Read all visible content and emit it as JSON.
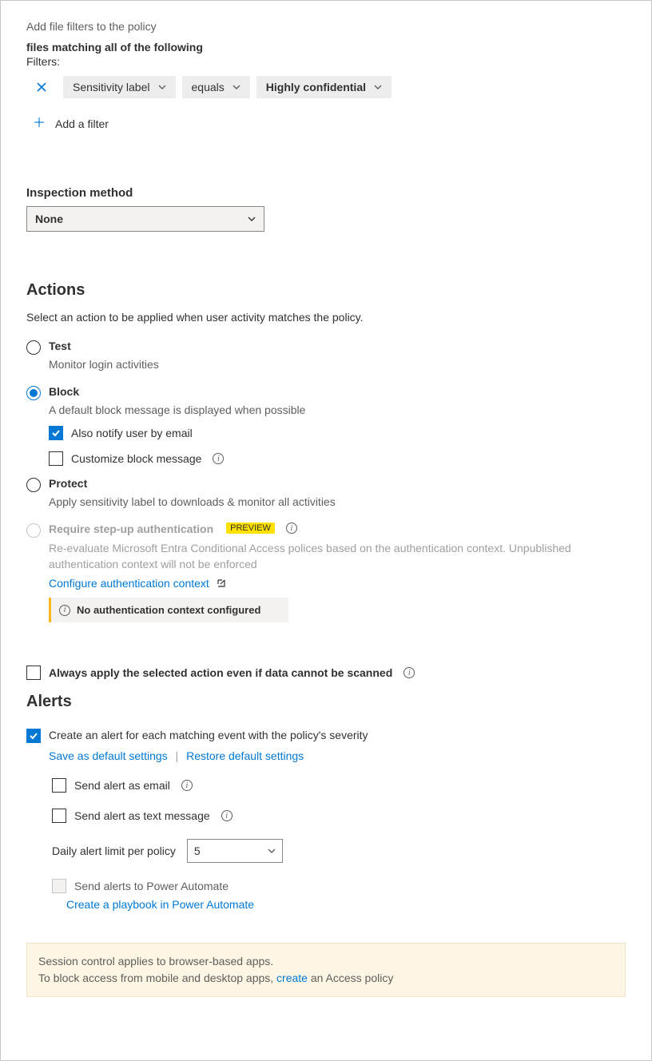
{
  "intro": "Add file filters to the policy",
  "matching_header": "files matching all of the following",
  "filters_label": "Filters:",
  "filter": {
    "field": "Sensitivity label",
    "operator": "equals",
    "value": "Highly confidential"
  },
  "add_filter": "Add a filter",
  "inspection": {
    "label": "Inspection method",
    "value": "None"
  },
  "actions": {
    "heading": "Actions",
    "desc": "Select an action to be applied when user activity matches the policy.",
    "test": {
      "label": "Test",
      "sub": "Monitor login activities"
    },
    "block": {
      "label": "Block",
      "sub": "A default block message is displayed when possible",
      "notify_email": "Also notify user by email",
      "customize": "Customize block message"
    },
    "protect": {
      "label": "Protect",
      "sub": "Apply sensitivity label to downloads & monitor all activities"
    },
    "stepup": {
      "label": "Require step-up authentication",
      "badge": "PREVIEW",
      "desc": "Re-evaluate Microsoft Entra Conditional Access polices based on the authentication context. Unpublished authentication context will not be enforced",
      "configure_link": "Configure authentication context",
      "warning": "No authentication context configured"
    },
    "always_apply": "Always apply the selected action even if data cannot be scanned"
  },
  "alerts": {
    "heading": "Alerts",
    "create_alert": "Create an alert for each matching event with the policy's severity",
    "save_default": "Save as default settings",
    "restore_default": "Restore default settings",
    "send_email": "Send alert as email",
    "send_text": "Send alert as text message",
    "daily_limit_label": "Daily alert limit per policy",
    "daily_limit_value": "5",
    "power_automate": "Send alerts to Power Automate",
    "playbook_link": "Create a playbook in Power Automate"
  },
  "footer": {
    "line1": "Session control applies to browser-based apps.",
    "line2a": "To block access from mobile and desktop apps, ",
    "line2_link": "create",
    "line2b": " an Access policy"
  }
}
